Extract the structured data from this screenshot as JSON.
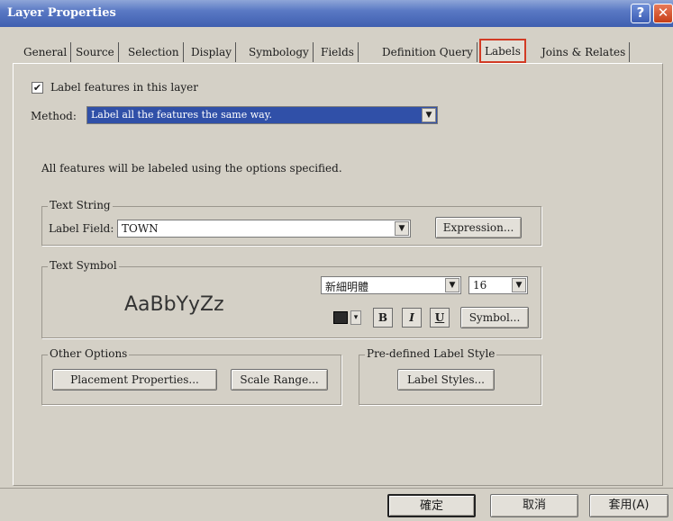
{
  "window": {
    "title": "Layer Properties",
    "help_label": "?",
    "close_label": "✕"
  },
  "tabs": [
    {
      "label": "General"
    },
    {
      "label": "Source"
    },
    {
      "label": "Selection"
    },
    {
      "label": "Display"
    },
    {
      "label": "Symbology"
    },
    {
      "label": "Fields"
    },
    {
      "label": "Definition Query"
    },
    {
      "label": "Labels",
      "active": true
    },
    {
      "label": "Joins & Relates"
    }
  ],
  "labels_tab": {
    "label_features_checkbox": {
      "label": "Label features in this layer",
      "checked": true,
      "mark": "✔"
    },
    "method": {
      "label": "Method:",
      "value": "Label all the features the same way."
    },
    "info_text": "All features will be labeled using the options specified.",
    "text_string": {
      "legend": "Text String",
      "field_label": "Label Field:",
      "field_value": "TOWN",
      "expression_button": "Expression..."
    },
    "text_symbol": {
      "legend": "Text Symbol",
      "preview": "AaBbYyZz",
      "font": "新細明體",
      "size": "16",
      "bold": "B",
      "italic": "I",
      "underline": "U",
      "symbol_button": "Symbol..."
    },
    "other_options": {
      "legend": "Other Options",
      "placement_button": "Placement Properties...",
      "scale_button": "Scale Range..."
    },
    "predefined_style": {
      "legend": "Pre-defined Label Style",
      "label_styles_button": "Label Styles..."
    }
  },
  "footer": {
    "ok": "確定",
    "cancel": "取消",
    "apply": "套用(A)"
  },
  "colors": {
    "titlebar": "#3f5fb0",
    "active_tab_border": "#d23b24",
    "method_highlight": "#3050a8",
    "text_color_swatch": "#2a2a2a"
  }
}
